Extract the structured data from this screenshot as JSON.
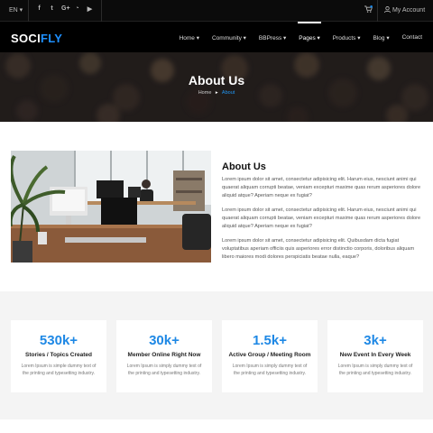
{
  "topbar": {
    "language": "EN ▾",
    "social_icons": [
      {
        "name": "facebook-icon",
        "glyph": "f"
      },
      {
        "name": "twitter-icon",
        "glyph": "t"
      },
      {
        "name": "google-plus-icon",
        "glyph": "G+"
      },
      {
        "name": "rss-icon",
        "glyph": "◔"
      },
      {
        "name": "youtube-icon",
        "glyph": "▶"
      }
    ],
    "cart_icon": "cart-icon",
    "account_icon": "user-icon",
    "account_label": "My Account"
  },
  "header": {
    "logo_main": "SOCI",
    "logo_accent": "FLY",
    "nav": [
      {
        "label": "Home ▾"
      },
      {
        "label": "Community ▾"
      },
      {
        "label": "BBPress ▾"
      },
      {
        "label": "Pages ▾",
        "active": true
      },
      {
        "label": "Products ▾"
      },
      {
        "label": "Blog ▾"
      },
      {
        "label": "Contact"
      }
    ]
  },
  "hero": {
    "title": "About Us",
    "breadcrumb_home": "Home",
    "breadcrumb_sep": "▸",
    "breadcrumb_current": "About"
  },
  "about": {
    "heading": "About Us",
    "paragraphs": [
      "Lorem ipsum dolor sit amet, consectetur adipisicing elit. Harum eius, nesciunt animi qui quaerat aliquam corrupti beatae, veniam excepturi maxime quas rerum asperiores dolore aliquid atque? Aperiam neque ex fugiat?",
      "Lorem ipsum dolor sit amet, consectetur adipisicing elit. Harum eius, nesciunt animi qui quaerat aliquam corrupti beatae, veniam excepturi maxime quas rerum asperiores dolore aliquid atque? Aperiam neque ex fugiat?",
      "Lorem ipsum dolor sit amet, consectetur adipisicing elit. Quibusdam dicta fugiat voluptatibus aperiam officiis quis asperiores error distinctio corporis, doloribus aliquam libero maiores modi dolores perspiciatis beatae nulla, eaque?"
    ]
  },
  "stats": [
    {
      "number": "530k+",
      "label": "Stories / Topics Created",
      "desc": "Lorem Ipsum is simple dummy text of the printing and typesetting industry."
    },
    {
      "number": "30k+",
      "label": "Member Online Right Now",
      "desc": "Lorem Ipsum is simply dummy text of the printing and typesetting industry."
    },
    {
      "number": "1.5k+",
      "label": "Active Group / Meeting Room",
      "desc": "Lorem Ipsum is simply dummy text of the printing and typesetting industry."
    },
    {
      "number": "3k+",
      "label": "New Event In Every Week",
      "desc": "Lorem Ipsum is simply dummy text of the printing and typesetting industry."
    }
  ],
  "colors": {
    "accent": "#1e88e5",
    "topbar_bg": "#0b0b0b",
    "header_bg": "#000000",
    "stats_bg": "#f4f4f4"
  }
}
